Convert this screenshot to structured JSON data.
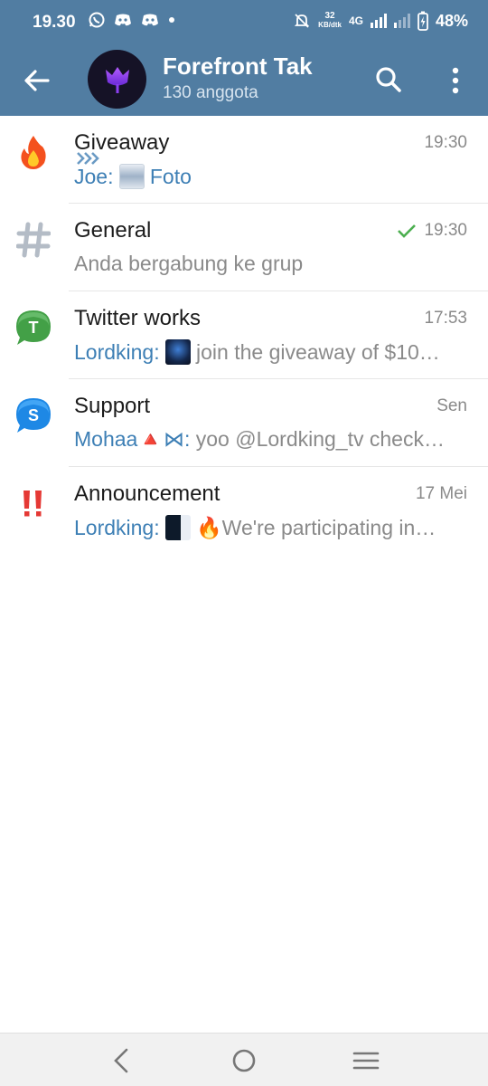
{
  "status_bar": {
    "time": "19.30",
    "net_speed_value": "32",
    "net_speed_unit": "KB/dtk",
    "network_type": "4G",
    "battery": "48%"
  },
  "app_bar": {
    "title": "Forefront Tak",
    "subtitle": "130 anggota",
    "accent_color": "#517da2"
  },
  "topics": [
    {
      "name": "Giveaway",
      "time": "19:30",
      "sender": "Joe:",
      "message": "Foto",
      "icon": "fire-icon"
    },
    {
      "name": "General",
      "time": "19:30",
      "sender": "",
      "message": "Anda bergabung ke grup",
      "icon": "hashtag-icon",
      "read_check": true
    },
    {
      "name": "Twitter works",
      "time": "17:53",
      "sender": "Lordking:",
      "message": "join the giveaway of $10…",
      "icon": "t-bubble-icon"
    },
    {
      "name": "Support",
      "time": "Sen",
      "sender": "Mohaa🔺⋈:",
      "message": "yoo @Lordking_tv check…",
      "icon": "s-bubble-icon"
    },
    {
      "name": "Announcement",
      "time": "17 Mei",
      "sender": "Lordking:",
      "message": "🔥We're participating in…",
      "icon": "double-exclamation-icon"
    }
  ]
}
